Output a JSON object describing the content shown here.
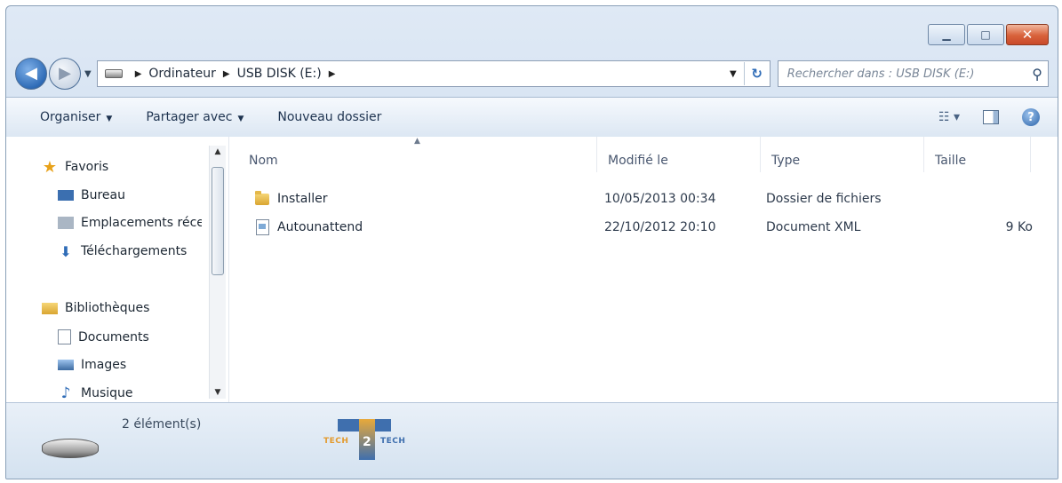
{
  "window": {
    "minimize_icon": "minimize-icon",
    "maximize_icon": "maximize-icon",
    "close_icon": "close-icon"
  },
  "address": {
    "segments": [
      "Ordinateur",
      "USB DISK (E:)"
    ],
    "search_placeholder": "Rechercher dans : USB DISK (E:)"
  },
  "toolbar": {
    "organize": "Organiser",
    "share": "Partager avec",
    "new_folder": "Nouveau dossier"
  },
  "nav": {
    "favorites_header": "Favoris",
    "favorites": [
      "Bureau",
      "Emplacements récents",
      "Téléchargements"
    ],
    "libraries_header": "Bibliothèques",
    "libraries": [
      "Documents",
      "Images",
      "Musique"
    ]
  },
  "columns": {
    "name": "Nom",
    "modified": "Modifié le",
    "type": "Type",
    "size": "Taille"
  },
  "files": [
    {
      "name": "Installer",
      "modified": "10/05/2013 00:34",
      "type": "Dossier de fichiers",
      "size": "",
      "icon": "folder-icon"
    },
    {
      "name": "Autounattend",
      "modified": "22/10/2012 20:10",
      "type": "Document XML",
      "size": "9 Ko",
      "icon": "xml-document-icon"
    }
  ],
  "status": {
    "count": "2 élément(s)"
  },
  "logo": {
    "left": "TECH",
    "num": "2",
    "right": "TECH"
  }
}
